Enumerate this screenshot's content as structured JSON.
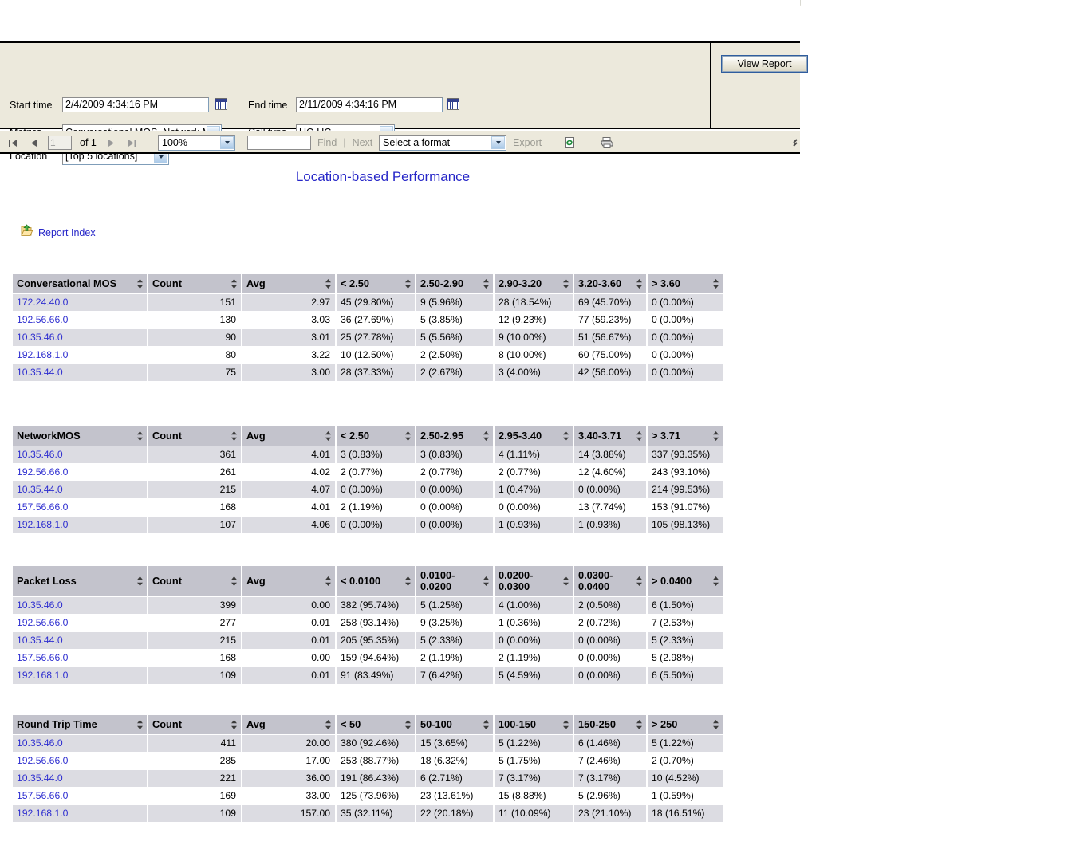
{
  "parameters": {
    "start_time": {
      "label": "Start time",
      "value": "2/4/2009 4:34:16 PM",
      "calendar_icon": "calendar-icon"
    },
    "end_time": {
      "label": "End time",
      "value": "2/11/2009 4:34:16 PM",
      "calendar_icon": "calendar-icon"
    },
    "metrics": {
      "label": "Metrics",
      "value": "Conversational MOS, Network M"
    },
    "call_type": {
      "label": "Call type",
      "value": "UC-UC"
    },
    "location": {
      "label": "Location",
      "value": "[Top 5 locations]"
    },
    "view_report_button": "View Report"
  },
  "toolbar": {
    "first_page_icon": "first-page-icon",
    "prev_page_icon": "previous-page-icon",
    "page_number": "1",
    "of_pages": "of 1",
    "next_page_icon": "next-page-icon",
    "last_page_icon": "last-page-icon",
    "zoom": "100%",
    "find_value": "",
    "find_label": "Find",
    "find_separator": "|",
    "next_label": "Next",
    "export_format": "Select a format",
    "export_label": "Export",
    "refresh_icon": "refresh-icon",
    "print_icon": "print-icon",
    "resize_icon": "resize-grip-icon"
  },
  "report": {
    "title": "Location-based Performance",
    "report_index_link": "Report Index",
    "report_index_icon": "report-index-icon"
  },
  "tables": [
    {
      "id": "conversational-mos",
      "headers": [
        "Conversational MOS",
        "Count",
        "Avg",
        "< 2.50",
        "2.50-2.90",
        "2.90-3.20",
        "3.20-3.60",
        "> 3.60"
      ],
      "rows": [
        [
          "172.24.40.0",
          "151",
          "2.97",
          "45 (29.80%)",
          "9 (5.96%)",
          "28 (18.54%)",
          "69 (45.70%)",
          "0 (0.00%)"
        ],
        [
          "192.56.66.0",
          "130",
          "3.03",
          "36 (27.69%)",
          "5 (3.85%)",
          "12 (9.23%)",
          "77 (59.23%)",
          "0 (0.00%)"
        ],
        [
          "10.35.46.0",
          "90",
          "3.01",
          "25 (27.78%)",
          "5 (5.56%)",
          "9 (10.00%)",
          "51 (56.67%)",
          "0 (0.00%)"
        ],
        [
          "192.168.1.0",
          "80",
          "3.22",
          "10 (12.50%)",
          "2 (2.50%)",
          "8 (10.00%)",
          "60 (75.00%)",
          "0 (0.00%)"
        ],
        [
          "10.35.44.0",
          "75",
          "3.00",
          "28 (37.33%)",
          "2 (2.67%)",
          "3 (4.00%)",
          "42 (56.00%)",
          "0 (0.00%)"
        ]
      ]
    },
    {
      "id": "network-mos",
      "headers": [
        "NetworkMOS",
        "Count",
        "Avg",
        "< 2.50",
        "2.50-2.95",
        "2.95-3.40",
        "3.40-3.71",
        "> 3.71"
      ],
      "rows": [
        [
          "10.35.46.0",
          "361",
          "4.01",
          "3 (0.83%)",
          "3 (0.83%)",
          "4 (1.11%)",
          "14 (3.88%)",
          "337 (93.35%)"
        ],
        [
          "192.56.66.0",
          "261",
          "4.02",
          "2 (0.77%)",
          "2 (0.77%)",
          "2 (0.77%)",
          "12 (4.60%)",
          "243 (93.10%)"
        ],
        [
          "10.35.44.0",
          "215",
          "4.07",
          "0 (0.00%)",
          "0 (0.00%)",
          "1 (0.47%)",
          "0 (0.00%)",
          "214 (99.53%)"
        ],
        [
          "157.56.66.0",
          "168",
          "4.01",
          "2 (1.19%)",
          "0 (0.00%)",
          "0 (0.00%)",
          "13 (7.74%)",
          "153 (91.07%)"
        ],
        [
          "192.168.1.0",
          "107",
          "4.06",
          "0 (0.00%)",
          "0 (0.00%)",
          "1 (0.93%)",
          "1 (0.93%)",
          "105 (98.13%)"
        ]
      ]
    },
    {
      "id": "packet-loss",
      "headers": [
        "Packet Loss",
        "Count",
        "Avg",
        "< 0.0100",
        "0.0100-0.0200",
        "0.0200-0.0300",
        "0.0300-0.0400",
        "> 0.0400"
      ],
      "rows": [
        [
          "10.35.46.0",
          "399",
          "0.00",
          "382 (95.74%)",
          "5 (1.25%)",
          "4 (1.00%)",
          "2 (0.50%)",
          "6 (1.50%)"
        ],
        [
          "192.56.66.0",
          "277",
          "0.01",
          "258 (93.14%)",
          "9 (3.25%)",
          "1 (0.36%)",
          "2 (0.72%)",
          "7 (2.53%)"
        ],
        [
          "10.35.44.0",
          "215",
          "0.01",
          "205 (95.35%)",
          "5 (2.33%)",
          "0 (0.00%)",
          "0 (0.00%)",
          "5 (2.33%)"
        ],
        [
          "157.56.66.0",
          "168",
          "0.00",
          "159 (94.64%)",
          "2 (1.19%)",
          "2 (1.19%)",
          "0 (0.00%)",
          "5 (2.98%)"
        ],
        [
          "192.168.1.0",
          "109",
          "0.01",
          "91 (83.49%)",
          "7 (6.42%)",
          "5 (4.59%)",
          "0 (0.00%)",
          "6 (5.50%)"
        ]
      ]
    },
    {
      "id": "round-trip-time",
      "headers": [
        "Round Trip Time",
        "Count",
        "Avg",
        "< 50",
        "50-100",
        "100-150",
        "150-250",
        "> 250"
      ],
      "rows": [
        [
          "10.35.46.0",
          "411",
          "20.00",
          "380 (92.46%)",
          "15 (3.65%)",
          "5 (1.22%)",
          "6 (1.46%)",
          "5 (1.22%)"
        ],
        [
          "192.56.66.0",
          "285",
          "17.00",
          "253 (88.77%)",
          "18 (6.32%)",
          "5 (1.75%)",
          "7 (2.46%)",
          "2 (0.70%)"
        ],
        [
          "10.35.44.0",
          "221",
          "36.00",
          "191 (86.43%)",
          "6 (2.71%)",
          "7 (3.17%)",
          "7 (3.17%)",
          "10 (4.52%)"
        ],
        [
          "157.56.66.0",
          "169",
          "33.00",
          "125 (73.96%)",
          "23 (13.61%)",
          "15 (8.88%)",
          "5 (2.96%)",
          "1 (0.59%)"
        ],
        [
          "192.168.1.0",
          "109",
          "157.00",
          "35 (32.11%)",
          "22 (20.18%)",
          "11 (10.09%)",
          "23 (21.10%)",
          "18 (16.51%)"
        ]
      ]
    }
  ],
  "colors": {
    "panel_bg": "#ece9dc",
    "header_bg": "#c3c3cc",
    "alt_row_bg": "#dcdce2",
    "link": "#2f2fd0",
    "title": "#2727c8"
  }
}
